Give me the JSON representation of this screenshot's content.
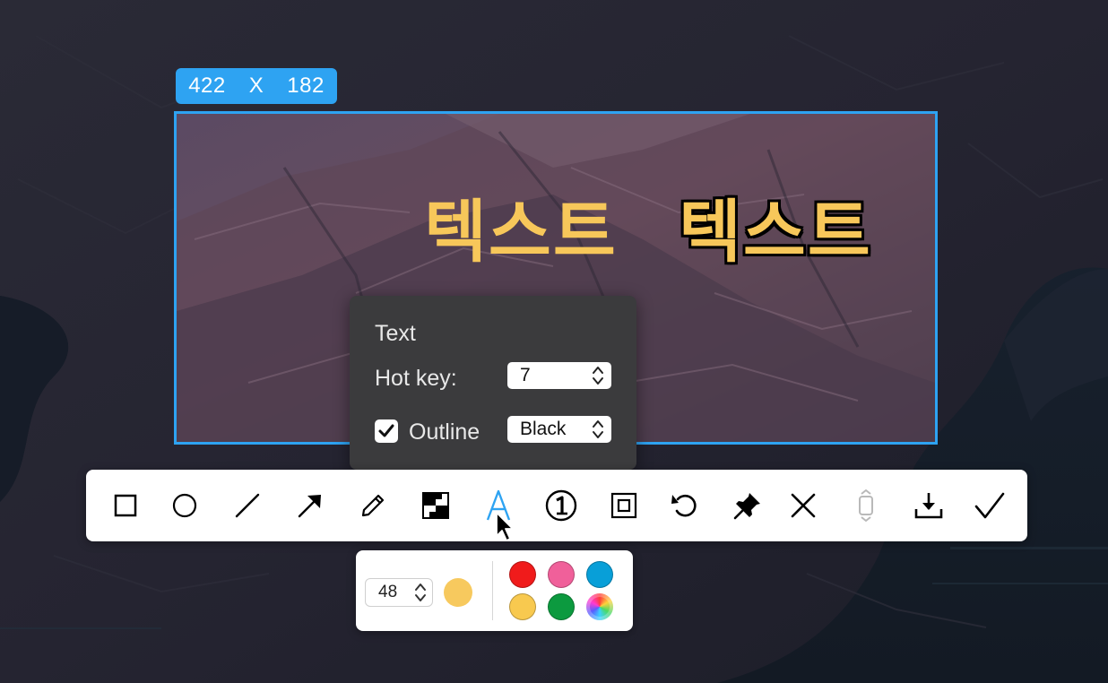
{
  "size_badge": {
    "width": "422",
    "separator": "X",
    "height": "182"
  },
  "canvas_text": {
    "plain": "텍스트",
    "outlined": "텍스트",
    "fill_color": "#f7c75a",
    "outline_color": "#000000"
  },
  "text_popover": {
    "title": "Text",
    "hotkey_label": "Hot key:",
    "hotkey_value": "7",
    "outline_label": "Outline",
    "outline_checked": true,
    "outline_color_value": "Black"
  },
  "toolbar": {
    "tools": [
      {
        "name": "rectangle-tool",
        "icon": "square-icon",
        "active": false
      },
      {
        "name": "ellipse-tool",
        "icon": "circle-icon",
        "active": false
      },
      {
        "name": "line-tool",
        "icon": "line-icon",
        "active": false
      },
      {
        "name": "arrow-tool",
        "icon": "arrow-icon",
        "active": false
      },
      {
        "name": "pencil-tool",
        "icon": "pencil-icon",
        "active": false
      },
      {
        "name": "mosaic-tool",
        "icon": "mosaic-icon",
        "active": false
      },
      {
        "name": "text-tool",
        "icon": "text-a-icon",
        "active": true
      },
      {
        "name": "number-tool",
        "icon": "circled-one-icon",
        "active": false
      },
      {
        "name": "crop-tool",
        "icon": "crop-frame-icon",
        "active": false
      },
      {
        "name": "undo-button",
        "icon": "undo-icon",
        "active": false
      },
      {
        "name": "pin-button",
        "icon": "pin-icon",
        "active": false
      },
      {
        "name": "cancel-button",
        "icon": "close-icon",
        "active": false
      },
      {
        "name": "scroll-capture-button",
        "icon": "scroll-capture-icon",
        "disabled": true
      },
      {
        "name": "save-button",
        "icon": "download-icon",
        "active": false
      },
      {
        "name": "confirm-button",
        "icon": "checkmark-icon",
        "active": false
      }
    ],
    "active_color": "#2ea3f2"
  },
  "color_panel": {
    "font_size": "48",
    "current_color": "#f7c95e",
    "swatches": [
      {
        "name": "red",
        "color": "#f01b1b"
      },
      {
        "name": "pink",
        "color": "#f0609a"
      },
      {
        "name": "blue",
        "color": "#089fd8"
      },
      {
        "name": "yellow",
        "color": "#f8c94f"
      },
      {
        "name": "green",
        "color": "#0c9a3f"
      },
      {
        "name": "custom-spectrum",
        "color": "spectrum"
      }
    ]
  }
}
